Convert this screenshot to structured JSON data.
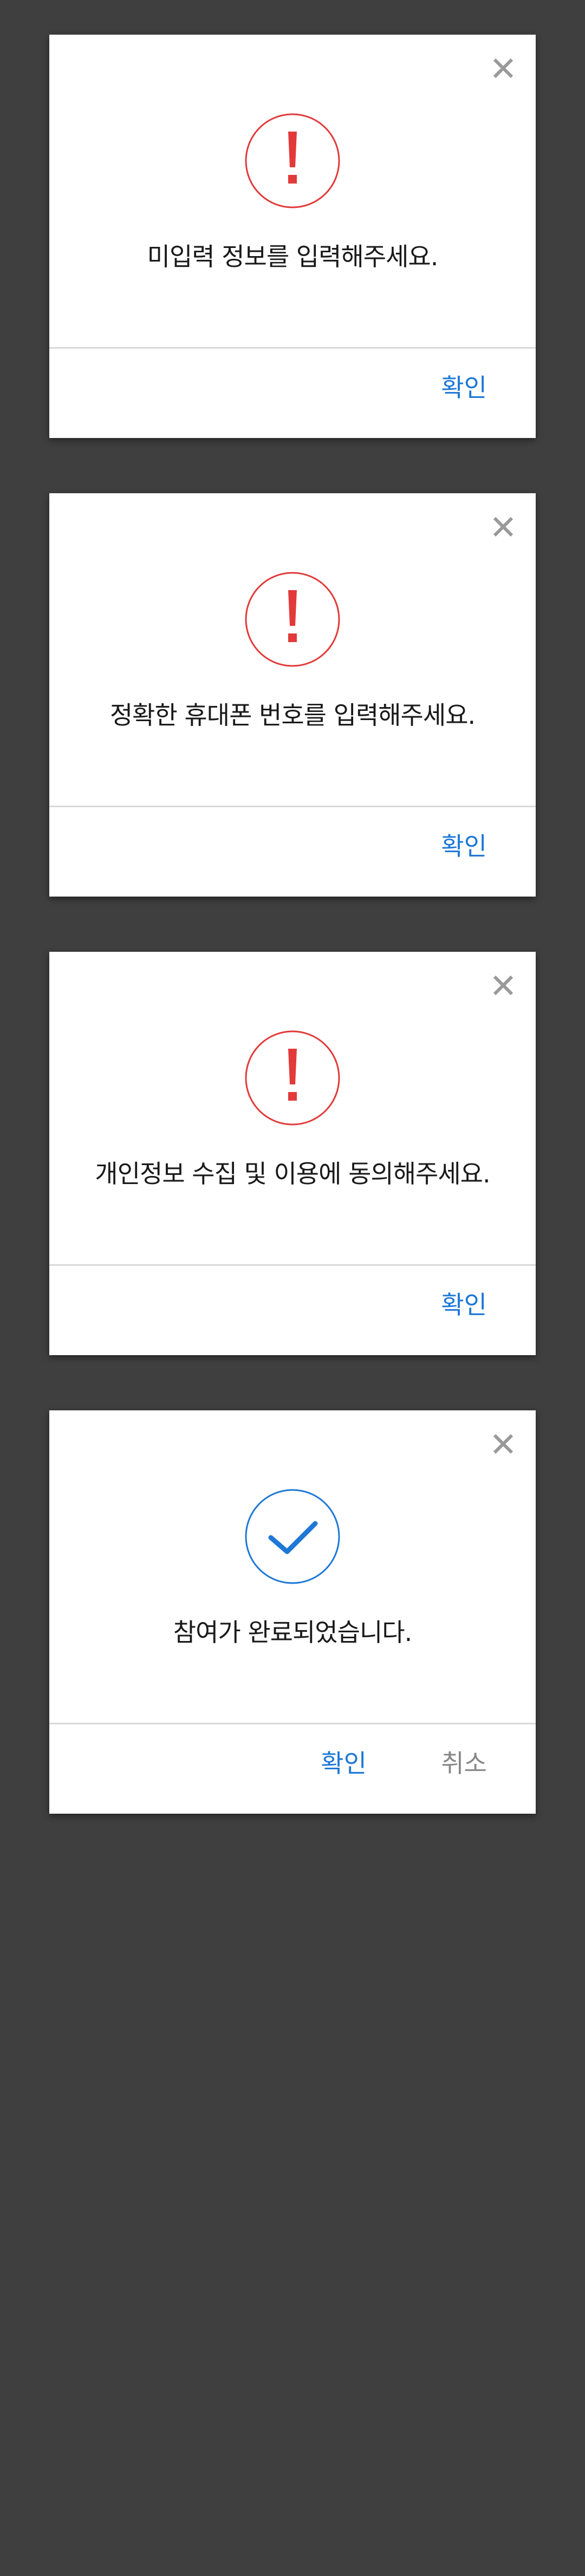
{
  "colors": {
    "background": "#3f3f3f",
    "dialog_background": "#ffffff",
    "error_accent": "#e23a3a",
    "success_accent": "#1e78d6",
    "confirm_text": "#1e78d6",
    "cancel_text": "#888888",
    "close_icon": "#999999"
  },
  "dialogs": [
    {
      "status_icon": "exclamation-icon",
      "message": "미입력 정보를 입력해주세요.",
      "confirm_label": "확인"
    },
    {
      "status_icon": "exclamation-icon",
      "message": "정확한 휴대폰 번호를 입력해주세요.",
      "confirm_label": "확인"
    },
    {
      "status_icon": "exclamation-icon",
      "message": "개인정보 수집 및 이용에 동의해주세요.",
      "confirm_label": "확인"
    },
    {
      "status_icon": "checkmark-icon",
      "message": "참여가 완료되었습니다.",
      "confirm_label": "확인",
      "cancel_label": "취소"
    }
  ]
}
